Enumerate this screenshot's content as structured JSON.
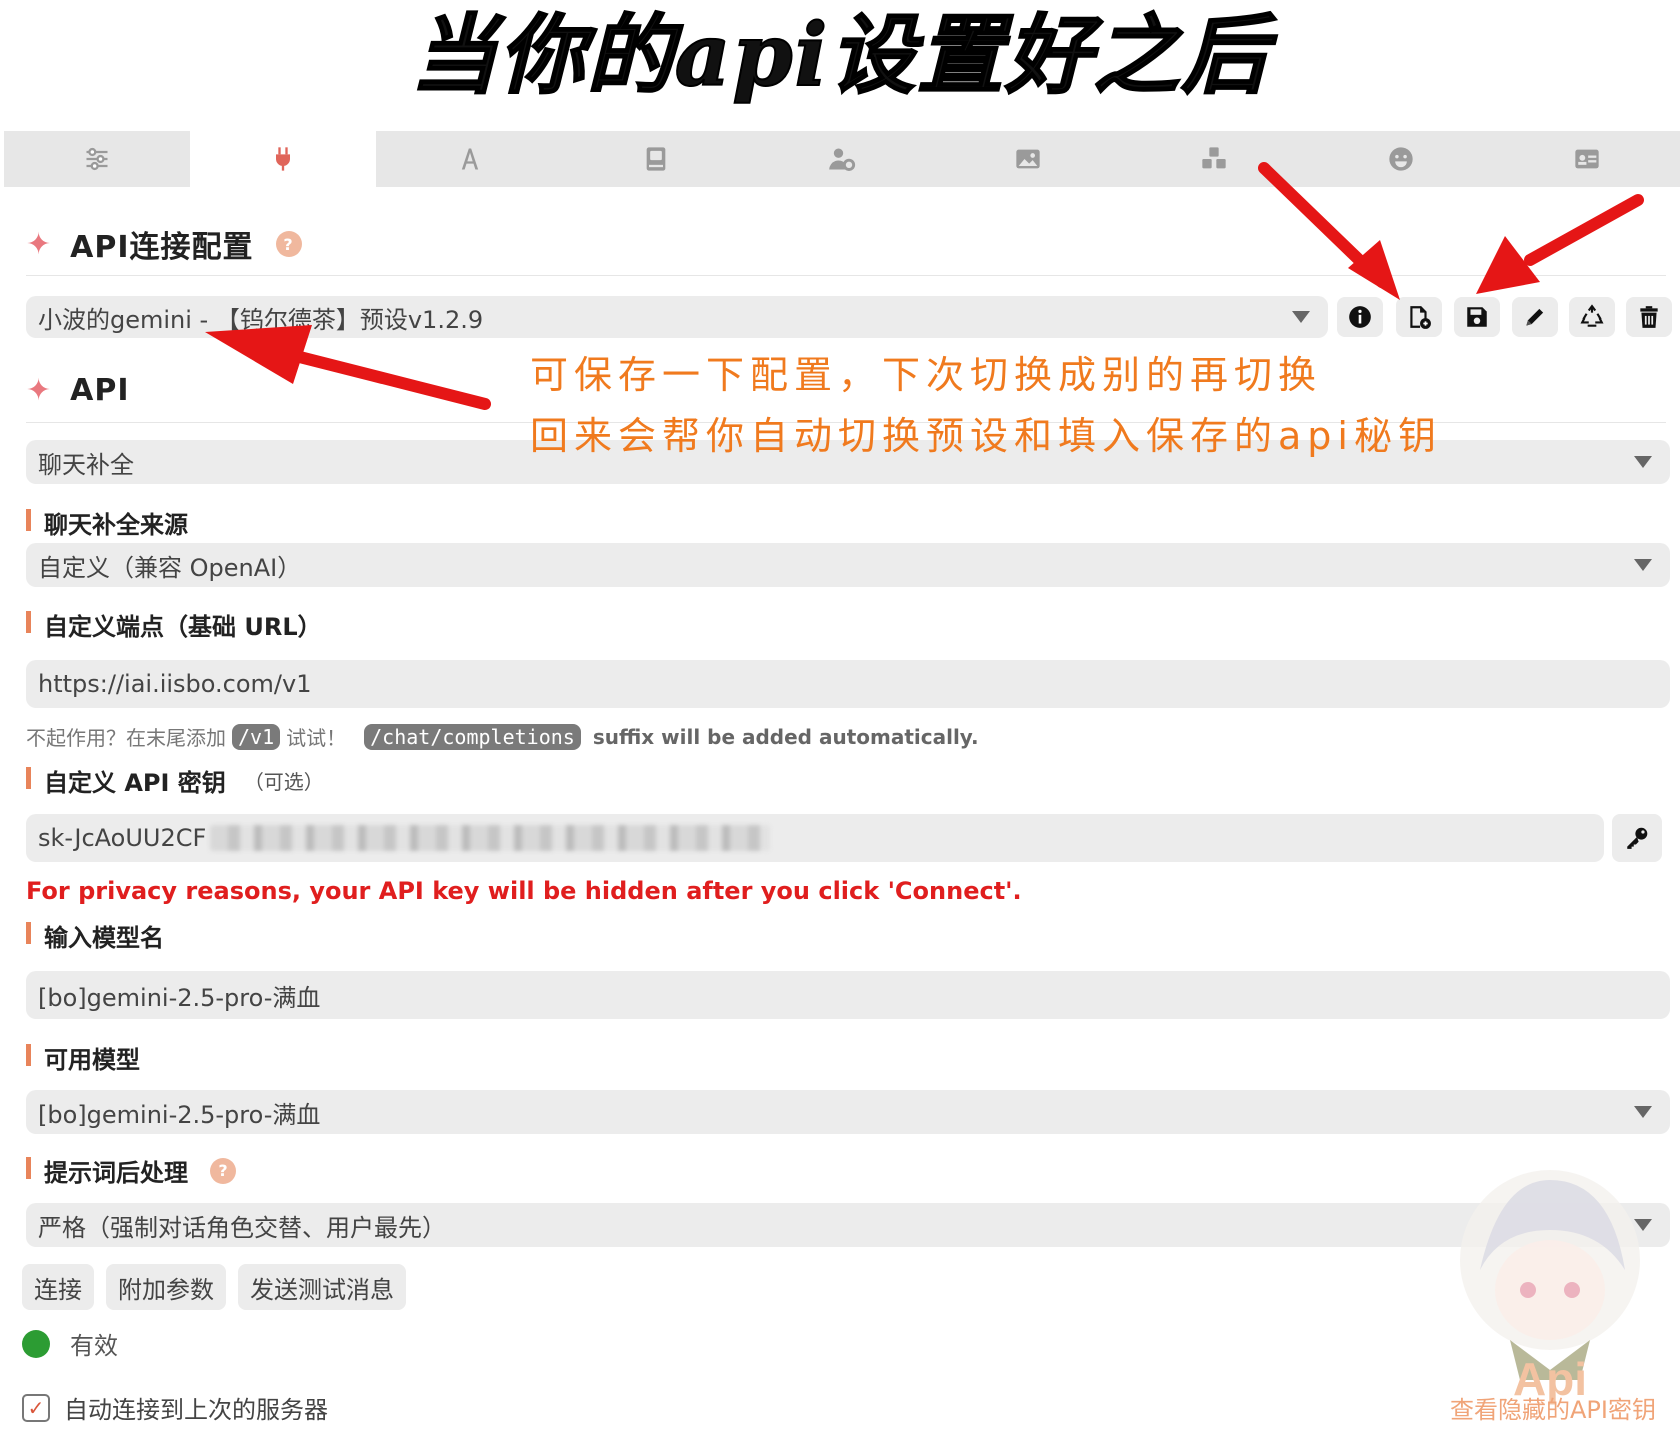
{
  "banner": {
    "title": "当你的api设置好之后"
  },
  "tabs": [
    {
      "icon": "sliders-icon",
      "active": false
    },
    {
      "icon": "plug-icon",
      "active": true
    },
    {
      "icon": "font-icon",
      "active": false
    },
    {
      "icon": "book-icon",
      "active": false
    },
    {
      "icon": "user-gear-icon",
      "active": false
    },
    {
      "icon": "image-icon",
      "active": false
    },
    {
      "icon": "cubes-icon",
      "active": false
    },
    {
      "icon": "smile-icon",
      "active": false
    },
    {
      "icon": "id-card-icon",
      "active": false
    }
  ],
  "connection": {
    "title": "API连接配置",
    "help": "?",
    "preset_value": "小波的gemini - 【钨尔德茶】预设v1.2.9",
    "toolbar": [
      "info-icon",
      "file-import-icon",
      "save-icon",
      "pencil-icon",
      "recycle-icon",
      "trash-icon"
    ]
  },
  "api": {
    "title": "API",
    "api_type_value": "聊天补全",
    "source_label": "聊天补全来源",
    "source_value": "自定义（兼容 OpenAI）",
    "endpoint_label": "自定义端点（基础 URL）",
    "endpoint_value": "https://iai.iisbo.com/v1",
    "hint_prefix": "不起作用？在末尾添加",
    "hint_code1": "/v1",
    "hint_mid": "试试！",
    "hint_code2": "/chat/completions",
    "hint_suffix": "suffix will be added automatically.",
    "key_label": "自定义 API 密钥",
    "key_optional": "（可选）",
    "key_value": "sk-JcAoUU2CF",
    "privacy_notice": "For privacy reasons, your API key will be hidden after you click 'Connect'.",
    "model_label": "输入模型名",
    "model_value": "[bo]gemini-2.5-pro-满血",
    "available_label": "可用模型",
    "available_value": "[bo]gemini-2.5-pro-满血",
    "postprocess_label": "提示词后处理",
    "postprocess_help": "?",
    "postprocess_value": "严格（强制对话角色交替、用户最先）",
    "buttons": {
      "connect": "连接",
      "extra_params": "附加参数",
      "send_test": "发送测试消息"
    },
    "status_text": "有效",
    "auto_connect_label": "自动连接到上次的服务器",
    "auto_connect_check": "✓"
  },
  "annotation": {
    "line1": "可保存一下配置，下次切换成别的再切换",
    "line2": "回来会帮你自动切换预设和填入保存的api秘钥"
  },
  "watermark": {
    "logo_text": "Api",
    "label": "查看隐藏的API密钥"
  },
  "colors": {
    "accent": "#e9787f",
    "label_bar": "#e8845a",
    "annotation": "#f07a1e",
    "arrow": "#e51616",
    "status_ok": "#2c9c33",
    "privacy": "#e01e1e"
  }
}
